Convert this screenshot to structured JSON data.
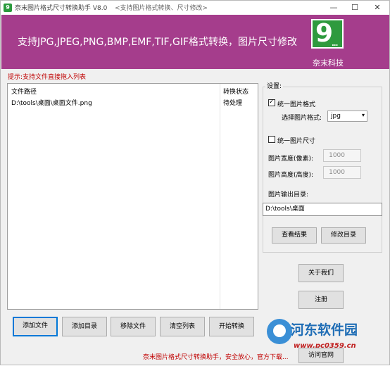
{
  "window": {
    "title": "奈末图片格式尺寸转换助手 V8.0",
    "subtitle": "<支持图片格式转换、尺寸修改>",
    "controls": {
      "minimize": "—",
      "maximize": "☐",
      "close": "✕"
    }
  },
  "banner": {
    "headline": "支持JPG,JPEG,PNG,BMP,EMF,TIF,GIF格式转换，图片尺寸修改",
    "logo_glyph": "9",
    "logo_dots": "...",
    "brand": "奈末科技",
    "color": "#a53d8c",
    "logo_color": "#2e9a3e"
  },
  "hint": "提示:支持文件直接拖入列表",
  "file_list": {
    "columns": [
      "文件路径",
      "转换状态"
    ],
    "rows": [
      {
        "path": "D:\\tools\\桌面\\桌面文件.png",
        "status": "待处理"
      }
    ]
  },
  "settings": {
    "title": "设置:",
    "unify_format": {
      "label": "统一图片格式",
      "checked": true
    },
    "format_label": "选择图片格式:",
    "format_value": "jpg",
    "unify_size": {
      "label": "统一图片尺寸",
      "checked": false
    },
    "width_label": "图片宽度(像素):",
    "width_value": "1000",
    "height_label": "图片高度(高度):",
    "height_value": "1000",
    "output_label": "图片输出目录:",
    "output_dir": "D:\\tools\\桌面",
    "view_result": "查看结果",
    "change_dir": "修改目录"
  },
  "side_buttons": {
    "about": "关于我们",
    "register": "注册",
    "visit": "访问官网"
  },
  "toolbar": {
    "add_file": "添加文件",
    "add_dir": "添加目录",
    "remove_file": "移除文件",
    "clear_list": "清空列表",
    "start": "开始转换"
  },
  "status_text": "奈末图片格式尺寸转换助手，安全放心，官方下载...",
  "watermark": {
    "name": "河东软件园",
    "url": "www.pc0359.cn"
  }
}
